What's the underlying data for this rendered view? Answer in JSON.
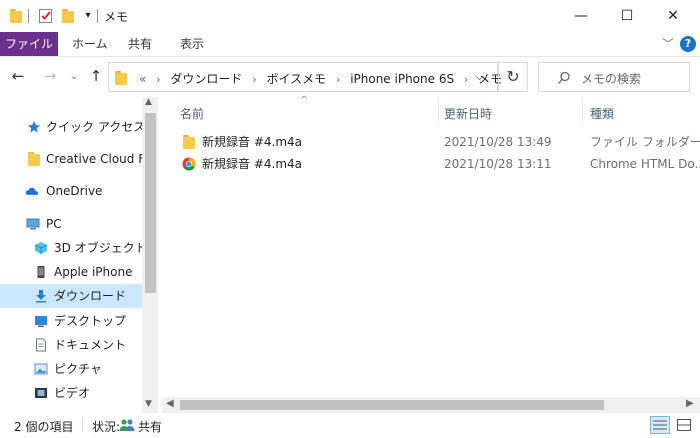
{
  "title": "メモ",
  "window_buttons": {
    "minimize": "—",
    "maximize": "☐",
    "close": "✕"
  },
  "ribbon": {
    "file": "ファイル",
    "tabs": [
      "ホーム",
      "共有",
      "表示"
    ],
    "collapse": "﹀",
    "help": "?"
  },
  "address": {
    "overflow": "«",
    "crumbs": [
      "ダウンロード",
      "ボイスメモ",
      "iPhone iPhone 6S",
      "メモ"
    ],
    "separator": "›",
    "dropdown": "⌵"
  },
  "nav_buttons": {
    "back": "←",
    "forward": "→",
    "recent": "⌄",
    "up": "↑"
  },
  "refresh": "↻",
  "search": {
    "placeholder": "メモの検索"
  },
  "nav_pane": [
    {
      "label": "クイック アクセス",
      "icon": "star-icon"
    },
    {
      "label": "Creative Cloud Files",
      "icon": "folder-icon"
    },
    {
      "label": "OneDrive",
      "icon": "cloud-icon"
    },
    {
      "label": "PC",
      "icon": "pc-icon"
    },
    {
      "label": "3D オブジェクト",
      "icon": "cube-icon"
    },
    {
      "label": "Apple iPhone",
      "icon": "phone-icon"
    },
    {
      "label": "ダウンロード",
      "icon": "download-icon",
      "selected": true
    },
    {
      "label": "デスクトップ",
      "icon": "desktop-icon"
    },
    {
      "label": "ドキュメント",
      "icon": "document-icon"
    },
    {
      "label": "ピクチャ",
      "icon": "picture-icon"
    },
    {
      "label": "ビデオ",
      "icon": "video-icon"
    }
  ],
  "columns": {
    "name": "名前",
    "date": "更新日時",
    "type": "種類",
    "sort_indicator": "^"
  },
  "files": [
    {
      "name": "新規録音 #4.m4a",
      "date": "2021/10/28 13:49",
      "type": "ファイル フォルダー",
      "icon": "folder-icon"
    },
    {
      "name": "新規録音 #4.m4a",
      "date": "2021/10/28 13:11",
      "type": "Chrome HTML Do...",
      "icon": "chrome-icon"
    }
  ],
  "status": {
    "count": "2 個の項目",
    "state_label": "状況:",
    "state_value": "共有"
  },
  "colors": {
    "file_tab": "#6b2f8e",
    "selection": "#cce8ff",
    "folder": "#f5c94a",
    "link_blue": "#4c607a"
  }
}
